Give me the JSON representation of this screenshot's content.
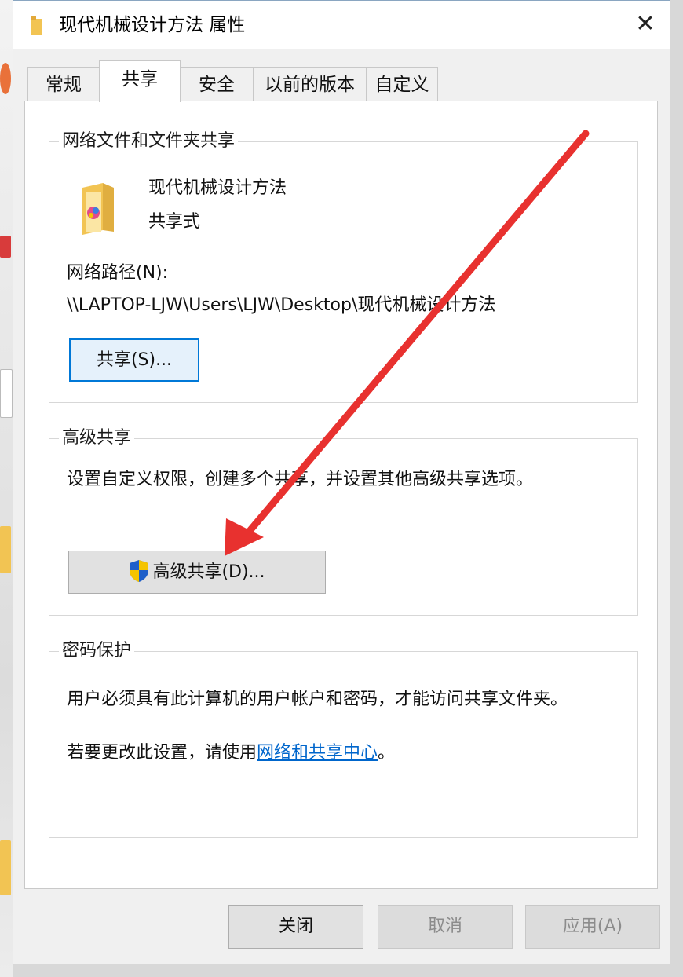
{
  "window": {
    "title": "现代机械设计方法 属性",
    "close_symbol": "✕"
  },
  "tabs": [
    {
      "label": "常规"
    },
    {
      "label": "共享"
    },
    {
      "label": "安全"
    },
    {
      "label": "以前的版本"
    },
    {
      "label": "自定义"
    }
  ],
  "network_share": {
    "group_title": "网络文件和文件夹共享",
    "folder_name": "现代机械设计方法",
    "share_state": "共享式",
    "path_label": "网络路径(N):",
    "path_value": "\\\\LAPTOP-LJW\\Users\\LJW\\Desktop\\现代机械设计方法",
    "share_button": "共享(S)..."
  },
  "advanced_share": {
    "group_title": "高级共享",
    "description": "设置自定义权限，创建多个共享，并设置其他高级共享选项。",
    "button": "高级共享(D)..."
  },
  "password": {
    "group_title": "密码保护",
    "line1": "用户必须具有此计算机的用户帐户和密码，才能访问共享文件夹。",
    "line2_prefix": "若要更改此设置，请使用",
    "line2_link": "网络和共享中心",
    "line2_suffix": "。"
  },
  "footer": {
    "ok": "关闭",
    "cancel": "取消",
    "apply": "应用(A)"
  },
  "icons": {
    "folder": "folder-icon",
    "shield": "uac-shield-icon",
    "annotation": "red-arrow"
  },
  "colors": {
    "accent": "#0078d7",
    "link": "#0066cc",
    "arrow": "#e8312f",
    "shield_blue": "#1e5fc9",
    "shield_yellow": "#f5c400"
  }
}
